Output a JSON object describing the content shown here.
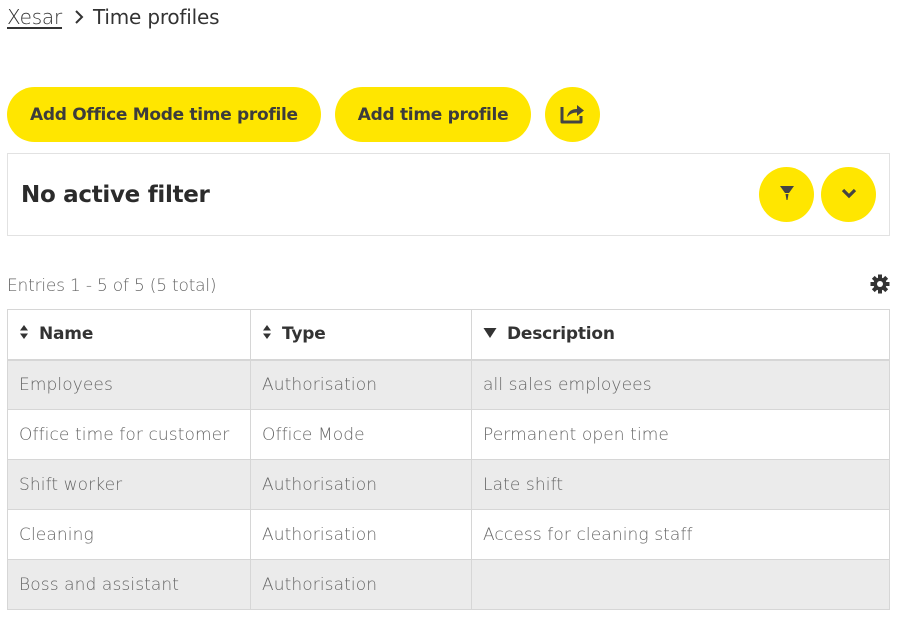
{
  "breadcrumb": {
    "root": "Xesar",
    "current": "Time profiles"
  },
  "actions": {
    "add_office_mode_label": "Add Office Mode time profile",
    "add_time_profile_label": "Add time profile",
    "export_icon": "share-export-icon"
  },
  "filter": {
    "status": "No active filter",
    "filter_icon": "funnel-icon",
    "expand_icon": "chevron-down-icon"
  },
  "entries": {
    "summary": "Entries 1 - 5 of 5 (5 total)",
    "settings_icon": "gear-icon"
  },
  "table": {
    "columns": [
      {
        "label": "Name",
        "sort": "none"
      },
      {
        "label": "Type",
        "sort": "none"
      },
      {
        "label": "Description",
        "sort": "descending"
      }
    ],
    "rows": [
      {
        "name": "Employees",
        "type": "Authorisation",
        "description": "all sales employees"
      },
      {
        "name": "Office time for customer",
        "type": "Office Mode",
        "description": "Permanent open time"
      },
      {
        "name": "Shift worker",
        "type": "Authorisation",
        "description": "Late shift"
      },
      {
        "name": "Cleaning",
        "type": "Authorisation",
        "description": "Access for cleaning staff"
      },
      {
        "name": "Boss and assistant",
        "type": "Authorisation",
        "description": ""
      }
    ]
  },
  "colors": {
    "accent": "#ffe600",
    "text_dark": "#333333",
    "row_alt": "#ebebeb"
  }
}
